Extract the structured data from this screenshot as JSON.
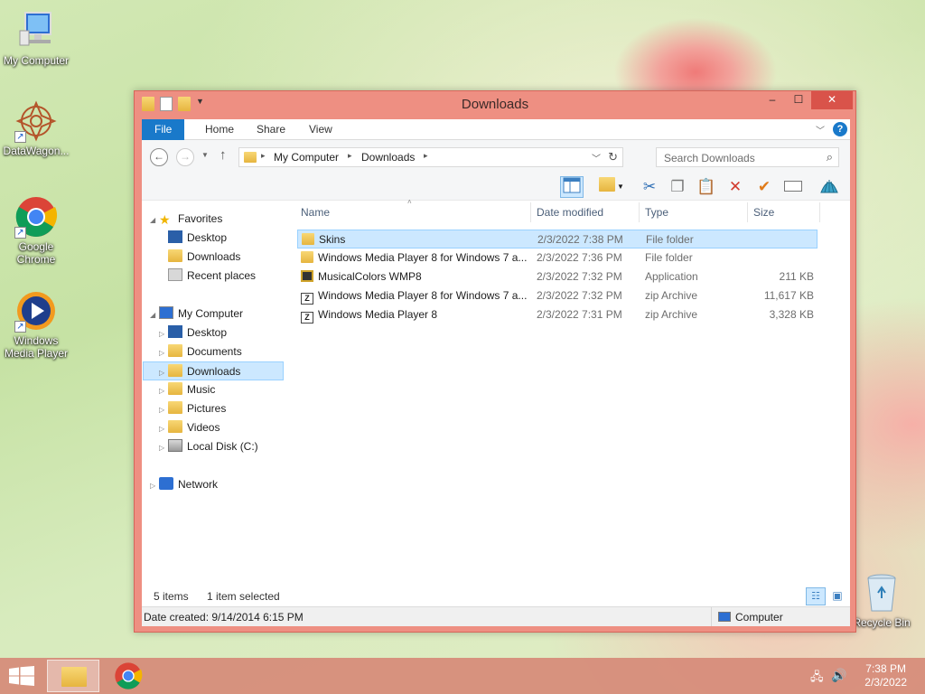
{
  "desktop": {
    "icons": [
      {
        "label": "My Computer"
      },
      {
        "label": "DataWagon..."
      },
      {
        "label": "Google Chrome"
      },
      {
        "label": "Windows Media Player"
      },
      {
        "label": "Recycle Bin"
      }
    ]
  },
  "window": {
    "title": "Downloads",
    "controls": {
      "minimize": "–",
      "maximize": "☐",
      "close": "✕"
    },
    "ribbon_tabs": [
      "File",
      "Home",
      "Share",
      "View"
    ],
    "address": {
      "segments": [
        "My Computer",
        "Downloads"
      ]
    },
    "search": {
      "placeholder": "Search Downloads"
    },
    "nav_pane": {
      "favorites": {
        "label": "Favorites",
        "items": [
          "Desktop",
          "Downloads",
          "Recent places"
        ]
      },
      "computer": {
        "label": "My Computer",
        "items": [
          "Desktop",
          "Documents",
          "Downloads",
          "Music",
          "Pictures",
          "Videos",
          "Local Disk (C:)"
        ]
      },
      "network": {
        "label": "Network"
      }
    },
    "columns": {
      "name": "Name",
      "date": "Date modified",
      "type": "Type",
      "size": "Size"
    },
    "files": [
      {
        "name": "Skins",
        "date": "2/3/2022 7:38 PM",
        "type": "File folder",
        "size": "",
        "icon": "folder-icon"
      },
      {
        "name": "Windows Media Player 8 for Windows 7 a...",
        "date": "2/3/2022 7:36 PM",
        "type": "File folder",
        "size": "",
        "icon": "folder-icon"
      },
      {
        "name": "MusicalColors WMP8",
        "date": "2/3/2022 7:32 PM",
        "type": "Application",
        "size": "211 KB",
        "icon": "application-icon"
      },
      {
        "name": "Windows Media Player 8 for Windows 7 a...",
        "date": "2/3/2022 7:32 PM",
        "type": "zip Archive",
        "size": "11,617 KB",
        "icon": "zip-icon"
      },
      {
        "name": "Windows Media Player 8",
        "date": "2/3/2022 7:31 PM",
        "type": "zip Archive",
        "size": "3,328 KB",
        "icon": "zip-icon"
      }
    ],
    "status": {
      "items": "5 items",
      "selected": "1 item selected"
    },
    "details": {
      "created": "Date created: 9/14/2014 6:15 PM",
      "location": "Computer"
    }
  },
  "taskbar": {
    "time": "7:38 PM",
    "date": "2/3/2022"
  },
  "colors": {
    "window_frame": "#ee8f82",
    "file_tab": "#1979ca",
    "selection": "#cce8ff"
  }
}
